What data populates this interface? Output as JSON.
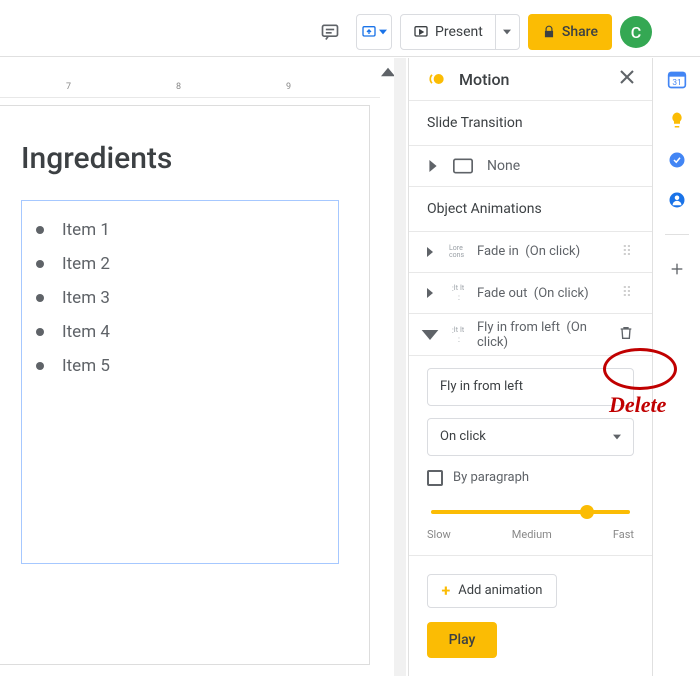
{
  "toolbar": {
    "present_label": "Present",
    "share_label": "Share",
    "avatar_letter": "C"
  },
  "ruler": {
    "ticks": [
      "7",
      "8",
      "9"
    ]
  },
  "slide": {
    "title": "Ingredients",
    "items": [
      "Item 1",
      "Item 2",
      "Item 3",
      "Item 4",
      "Item 5"
    ]
  },
  "panel": {
    "title": "Motion",
    "slide_transition_label": "Slide Transition",
    "transition_value": "None",
    "object_animations_label": "Object Animations",
    "animations": [
      {
        "name": "Fade in",
        "trigger": "(On click)",
        "expanded": false
      },
      {
        "name": "Fade out",
        "trigger": "(On click)",
        "expanded": false
      },
      {
        "name": "Fly in from left",
        "trigger": "(On click)",
        "expanded": true
      }
    ],
    "detail": {
      "effect": "Fly in from left",
      "trigger": "On click",
      "by_paragraph_label": "By paragraph",
      "speed_labels": [
        "Slow",
        "Medium",
        "Fast"
      ]
    },
    "add_animation_label": "Add animation",
    "play_label": "Play"
  },
  "annotation": {
    "label": "Delete"
  }
}
